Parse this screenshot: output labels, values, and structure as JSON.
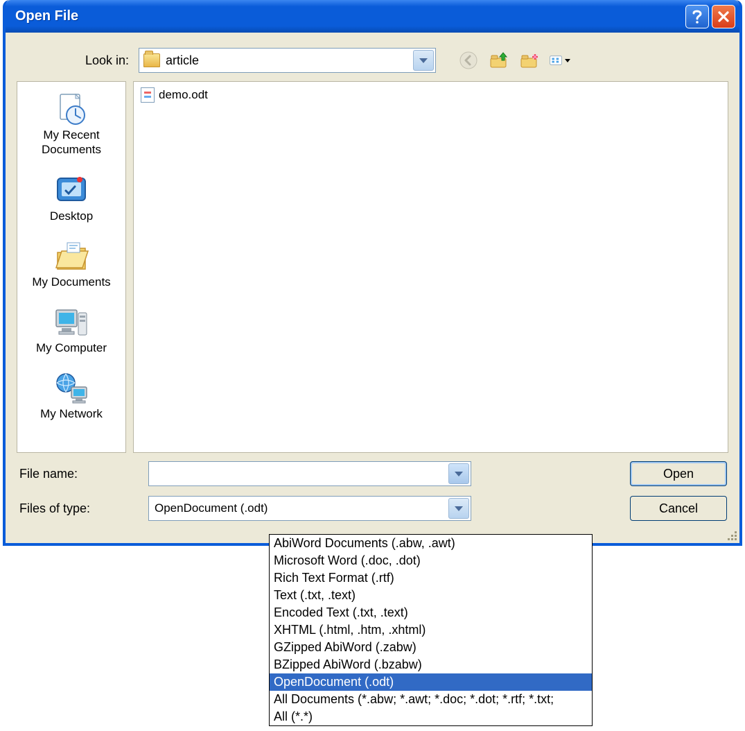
{
  "window": {
    "title": "Open File"
  },
  "lookin": {
    "label": "Look in:",
    "value": "article"
  },
  "places": [
    {
      "label": "My Recent Documents"
    },
    {
      "label": "Desktop"
    },
    {
      "label": "My Documents"
    },
    {
      "label": "My Computer"
    },
    {
      "label": "My Network"
    }
  ],
  "files": [
    {
      "name": "demo.odt"
    }
  ],
  "filename": {
    "label": "File name:",
    "value": ""
  },
  "filetype": {
    "label": "Files of type:",
    "value": "OpenDocument (.odt)",
    "options": [
      "AbiWord Documents (.abw, .awt)",
      "Microsoft Word (.doc, .dot)",
      "Rich Text Format (.rtf)",
      "Text (.txt, .text)",
      "Encoded Text (.txt, .text)",
      "XHTML (.html, .htm, .xhtml)",
      "GZipped AbiWord (.zabw)",
      "BZipped AbiWord (.bzabw)",
      "OpenDocument (.odt)",
      "All Documents (*.abw; *.awt; *.doc; *.dot; *.rtf; *.txt;",
      "All (*.*)"
    ]
  },
  "buttons": {
    "open": "Open",
    "cancel": "Cancel"
  }
}
